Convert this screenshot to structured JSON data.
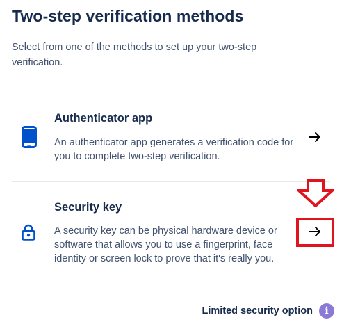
{
  "page": {
    "title": "Two-step verification methods",
    "subtitle": "Select from one of the methods to set up your two-step verification."
  },
  "methods": [
    {
      "title": "Authenticator app",
      "description": "An authenticator app generates a verification code for you to complete two-step verification.",
      "icon": "mobile-phone-icon",
      "action_icon": "arrow-right-icon"
    },
    {
      "title": "Security key",
      "description": "A security key can be physical hardware device or software that allows you to use a fingerprint, face identity or screen lock to prove that it's really you.",
      "icon": "padlock-icon",
      "action_icon": "arrow-right-icon",
      "highlighted": true
    }
  ],
  "footer": {
    "limited_label": "Limited security option",
    "info_glyph": "i"
  },
  "colors": {
    "accent": "#0052cc",
    "highlight": "#e0141e",
    "info_badge": "#8a7ad6",
    "text_primary": "#172b4d",
    "text_secondary": "#42526e"
  }
}
